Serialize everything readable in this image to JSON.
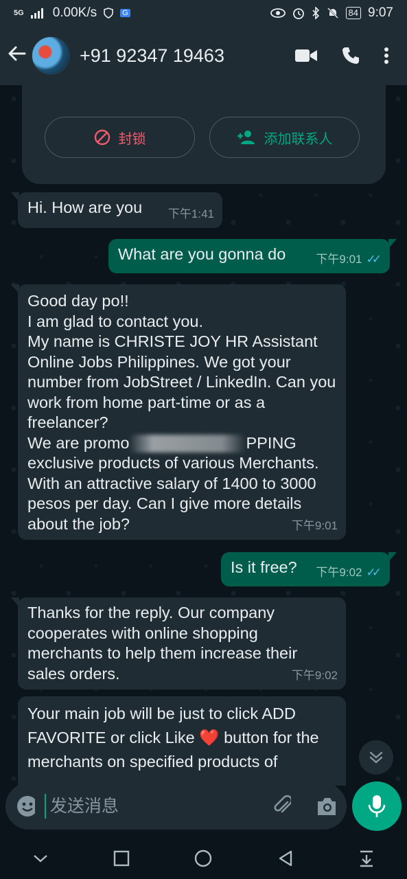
{
  "status_bar": {
    "signal": "5G",
    "speed": "0.00K/s",
    "battery": "84",
    "time": "9:07"
  },
  "header": {
    "contact": "+91 92347 19463"
  },
  "system_actions": {
    "block_label": "封锁",
    "add_contact_label": "添加联系人"
  },
  "messages": [
    {
      "dir": "in",
      "text": "Hi. How are you",
      "time": "下午1:41"
    },
    {
      "dir": "out",
      "text": "What are you gonna do",
      "time": "下午9:01"
    },
    {
      "dir": "in",
      "line1": "Good day po!!",
      "line2": "I am glad to contact you.",
      "line3": "My name is CHRISTE JOY HR Assistant Online Jobs Philippines. We got your number from JobStreet / LinkedIn. Can you work from home part-time or as a freelancer?",
      "line4a": "We are promo",
      "line4b": "PPING exclusive products of various Merchants. With an attractive salary of 1400 to 3000 pesos per day. Can I give more details about the job?",
      "time": "下午9:01"
    },
    {
      "dir": "out",
      "text": "Is it free?",
      "time": "下午9:02"
    },
    {
      "dir": "in",
      "text": "Thanks for the reply. Our company cooperates with online shopping merchants to help them increase their sales orders.",
      "time": "下午9:02"
    },
    {
      "dir": "in",
      "text_a": "Your main job will be just to click ADD FAVORITE or click Like",
      "emoji": "❤️",
      "text_b": "button for the merchants on specified products of"
    }
  ],
  "input": {
    "placeholder": "发送消息"
  }
}
